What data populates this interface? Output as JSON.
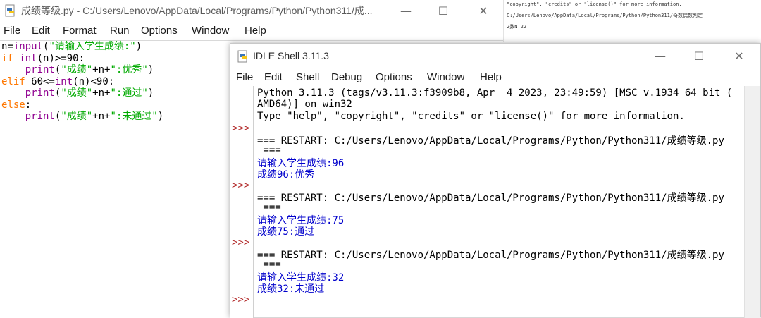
{
  "editor": {
    "title": "成绩等级.py - C:/Users/Lenovo/AppData/Local/Programs/Python/Python311/成...",
    "menu": [
      "File",
      "Edit",
      "Format",
      "Run",
      "Options",
      "Window",
      "Help"
    ],
    "code": {
      "l1_a": "n=",
      "l1_b": "input",
      "l1_c": "(",
      "l1_d": "\"请输入学生成绩:\"",
      "l1_e": ")",
      "l2_a": "if",
      "l2_b": " ",
      "l2_c": "int",
      "l2_d": "(n)>=90:",
      "l3_a": "    ",
      "l3_b": "print",
      "l3_c": "(",
      "l3_d": "\"成绩\"",
      "l3_e": "+n+",
      "l3_f": "\":优秀\"",
      "l3_g": ")",
      "l4_a": "elif",
      "l4_b": " 60<=",
      "l4_c": "int",
      "l4_d": "(n)<90:",
      "l5_a": "    ",
      "l5_b": "print",
      "l5_c": "(",
      "l5_d": "\"成绩\"",
      "l5_e": "+n+",
      "l5_f": "\":通过\"",
      "l5_g": ")",
      "l6_a": "else",
      "l6_b": ":",
      "l7_a": "    ",
      "l7_b": "print",
      "l7_c": "(",
      "l7_d": "\"成绩\"",
      "l7_e": "+n+",
      "l7_f": "\":未通过\"",
      "l7_g": ")"
    }
  },
  "bgdoc": {
    "line1": "\"copyright\", \"credits\" or \"license()\" for more information.",
    "line2": "C:/Users/Lenovo/AppData/Local/Programs/Python/Python311/奇数偶数判定",
    "line3": "2数N:22"
  },
  "shell": {
    "title": "IDLE Shell 3.11.3",
    "menu": [
      "File",
      "Edit",
      "Shell",
      "Debug",
      "Options",
      "Window",
      "Help"
    ],
    "prompt": ">>>",
    "lines": {
      "banner1": "Python 3.11.3 (tags/v3.11.3:f3909b8, Apr  4 2023, 23:49:59) [MSC v.1934 64 bit (",
      "banner2": "AMD64)] on win32",
      "banner3": "Type \"help\", \"copyright\", \"credits\" or \"license()\" for more information.",
      "restart": "=== RESTART: C:/Users/Lenovo/AppData/Local/Programs/Python/Python311/成绩等级.py",
      "restart_tail": " ===",
      "run1_in": "请输入学生成绩:96",
      "run1_out": "成绩96:优秀",
      "run2_in": "请输入学生成绩:75",
      "run2_out": "成绩75:通过",
      "run3_in": "请输入学生成绩:32",
      "run3_out": "成绩32:未通过"
    }
  },
  "window_controls": {
    "minimize": "—",
    "maximize": "☐",
    "close": "✕"
  },
  "colors": {
    "keyword": "#ff7700",
    "builtin": "#900090",
    "string": "#00aa00",
    "output": "#0000cc",
    "prompt": "#b42e2e"
  }
}
